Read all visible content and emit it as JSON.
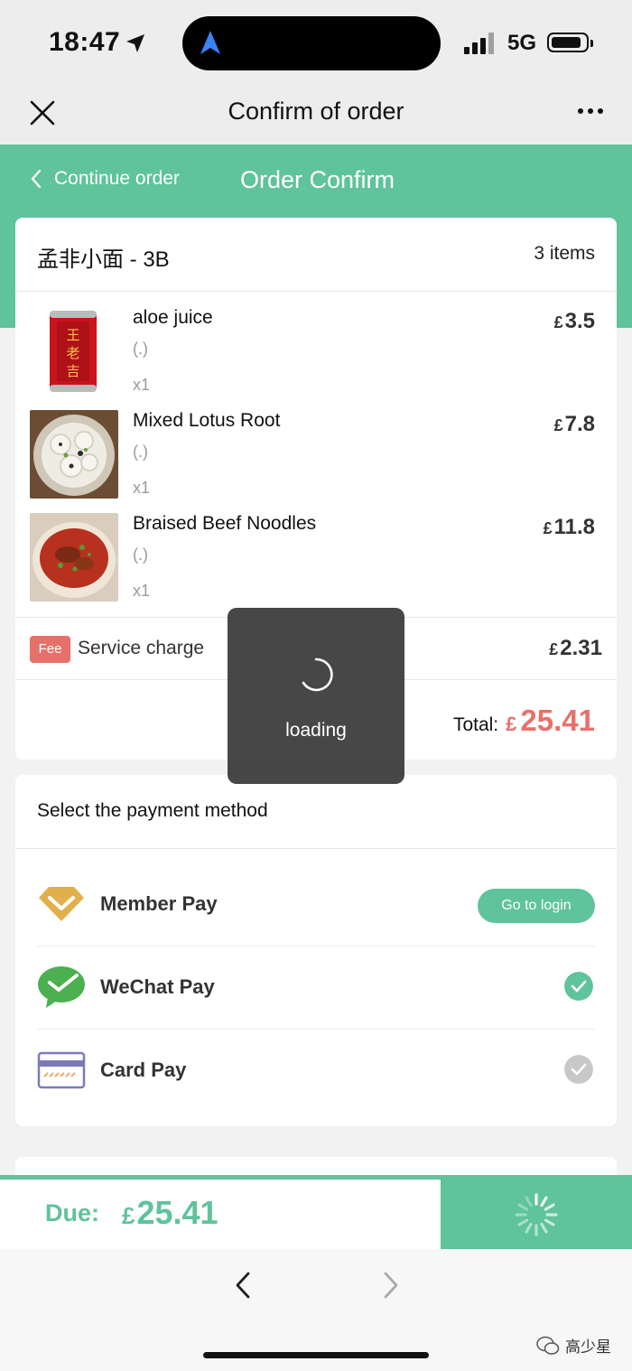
{
  "status_bar": {
    "time": "18:47",
    "network": "5G"
  },
  "nav": {
    "title": "Confirm of order"
  },
  "header": {
    "back_label": "Continue order",
    "title": "Order Confirm"
  },
  "order": {
    "shop_name": "孟非小面 - 3B",
    "items_count": "3 items",
    "currency": "£",
    "items": [
      {
        "name": "aloe juice",
        "spec": "(.)",
        "qty": "x1",
        "price": "3.5"
      },
      {
        "name": "Mixed Lotus Root",
        "spec": "(.)",
        "qty": "x1",
        "price": "7.8"
      },
      {
        "name": "Braised Beef Noodles",
        "spec": "(.)",
        "qty": "x1",
        "price": "11.8"
      }
    ],
    "fee": {
      "badge": "Fee",
      "label": "Service charge",
      "price": "2.31"
    },
    "total_label": "Total:",
    "total": "25.41"
  },
  "payment": {
    "title": "Select the payment method",
    "methods": [
      {
        "label": "Member Pay",
        "action": "Go to login"
      },
      {
        "label": "WeChat Pay",
        "selected": true
      },
      {
        "label": "Card Pay",
        "selected": false
      }
    ]
  },
  "bottom": {
    "due_label": "Due:",
    "due_value": "25.41"
  },
  "toast": {
    "text": "loading"
  },
  "watermark": {
    "text": "高少星"
  },
  "colors": {
    "brand": "#5fc39b",
    "accent_red": "#e8706b",
    "member_gold": "#e1b04c",
    "wechat_green": "#4caf50"
  }
}
